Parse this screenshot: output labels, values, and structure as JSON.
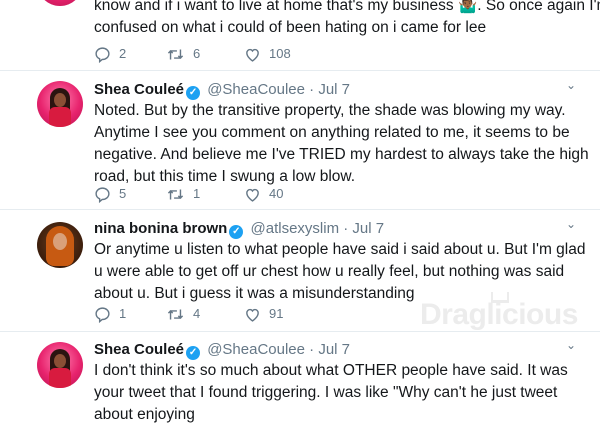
{
  "tweet0": {
    "text_line1": "know and if i want to live at home that's my business 🤷🏾‍♂️. So once again I'm",
    "text_line2": "confused on what i could of been hating on i came for lee",
    "replies": "2",
    "retweets": "6",
    "likes": "108"
  },
  "tweet1": {
    "name": "Shea Couleé",
    "handle": "@SheaCoulee",
    "date": "Jul 7",
    "text": "Noted. But by the transitive property, the shade was blowing my way. Anytime I see you comment on anything related to me, it seems to be negative. And believe me I've TRIED my hardest to always take the high road, but this time I swung a low blow.",
    "replies": "5",
    "retweets": "1",
    "likes": "40"
  },
  "tweet2": {
    "name": "nina bonina brown",
    "handle": "@atlsexyslim",
    "date": "Jul 7",
    "text": "Or anytime u listen to what people have said i said about u. But I'm glad u were able to get off ur chest how u really feel, but nothing was said about u. But i guess it was a misunderstanding",
    "replies": "1",
    "retweets": "4",
    "likes": "91"
  },
  "tweet3": {
    "name": "Shea Couleé",
    "handle": "@SheaCoulee",
    "date": "Jul 7",
    "text": "I don't think it's so much about what OTHER people have said. It was your tweet that I found triggering. I was like \"Why can't he just tweet about enjoying"
  },
  "watermark": "Draglicious",
  "sep": "·",
  "verified_glyph": "✓",
  "chevron_glyph": "⌄",
  "colors": {
    "text": "#14171a",
    "muted": "#657786",
    "verified": "#1da1f2",
    "divider": "#e6ecf0"
  }
}
